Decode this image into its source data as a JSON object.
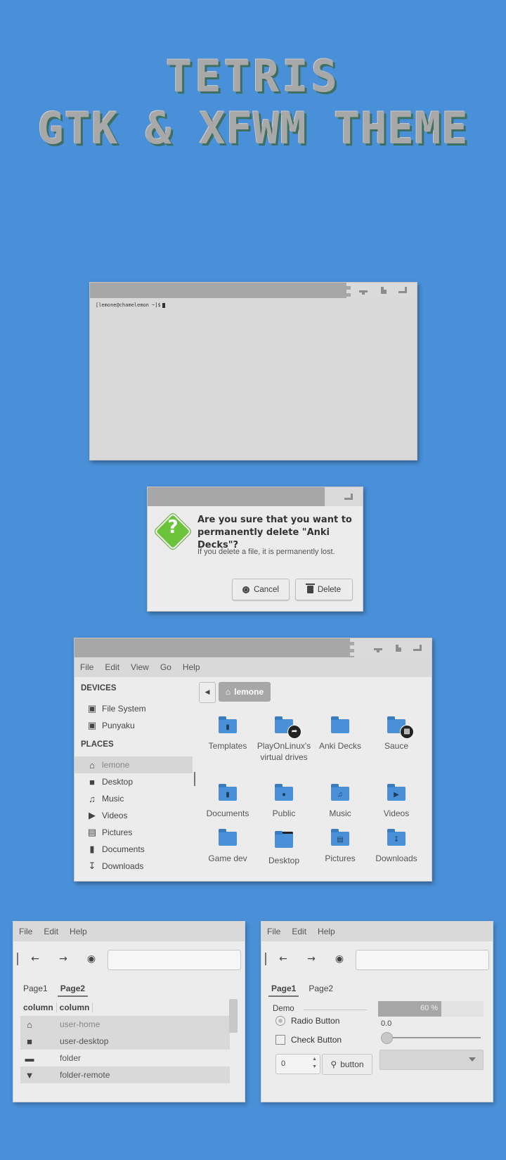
{
  "title": {
    "line1": "TETRIS",
    "line2": "GTK & XFWM THEME"
  },
  "terminal": {
    "prompt": "[lemone@chamelemon ~]$"
  },
  "dialog": {
    "heading": "Are you sure that you want to permanently delete \"Anki Decks\"?",
    "message": "If you delete a file, it is permanently lost.",
    "cancel_label": "Cancel",
    "delete_label": "Delete"
  },
  "file_manager": {
    "menu": [
      "File",
      "Edit",
      "View",
      "Go",
      "Help"
    ],
    "devices_heading": "DEVICES",
    "devices": [
      {
        "label": "File System",
        "icon": "drive-icon"
      },
      {
        "label": "Punyaku",
        "icon": "drive-icon"
      }
    ],
    "places_heading": "PLACES",
    "places": [
      {
        "label": "lemone",
        "icon": "home-icon"
      },
      {
        "label": "Desktop",
        "icon": "desktop-icon"
      },
      {
        "label": "Music",
        "icon": "music-icon"
      },
      {
        "label": "Videos",
        "icon": "video-icon"
      },
      {
        "label": "Pictures",
        "icon": "picture-icon"
      },
      {
        "label": "Documents",
        "icon": "document-icon"
      },
      {
        "label": "Downloads",
        "icon": "download-icon"
      }
    ],
    "path": "lemone",
    "items": [
      {
        "label": "Templates"
      },
      {
        "label": "PlayOnLinux's virtual drives"
      },
      {
        "label": "Anki Decks"
      },
      {
        "label": "Sauce"
      },
      {
        "label": "Documents"
      },
      {
        "label": "Public"
      },
      {
        "label": "Music"
      },
      {
        "label": "Videos"
      },
      {
        "label": "Game dev"
      },
      {
        "label": "Desktop"
      },
      {
        "label": "Pictures"
      },
      {
        "label": "Downloads"
      }
    ]
  },
  "demo_left": {
    "menu": [
      "File",
      "Edit",
      "Help"
    ],
    "tabs": [
      "Page1",
      "Page2"
    ],
    "columns": [
      "column",
      "column"
    ],
    "rows": [
      {
        "icon": "home-icon",
        "label": "user-home"
      },
      {
        "icon": "desktop-icon",
        "label": "user-desktop"
      },
      {
        "icon": "folder-icon",
        "label": "folder"
      },
      {
        "icon": "wifi-icon",
        "label": "folder-remote"
      }
    ]
  },
  "demo_right": {
    "menu": [
      "File",
      "Edit",
      "Help"
    ],
    "tabs": [
      "Page1",
      "Page2"
    ],
    "frame_label": "Demo",
    "radio_label": "Radio Button",
    "check_label": "Check Button",
    "spin_value": "0",
    "button_label": "button",
    "progress_label": "60 %",
    "progress": 0.6,
    "scale_value": "0.0"
  }
}
